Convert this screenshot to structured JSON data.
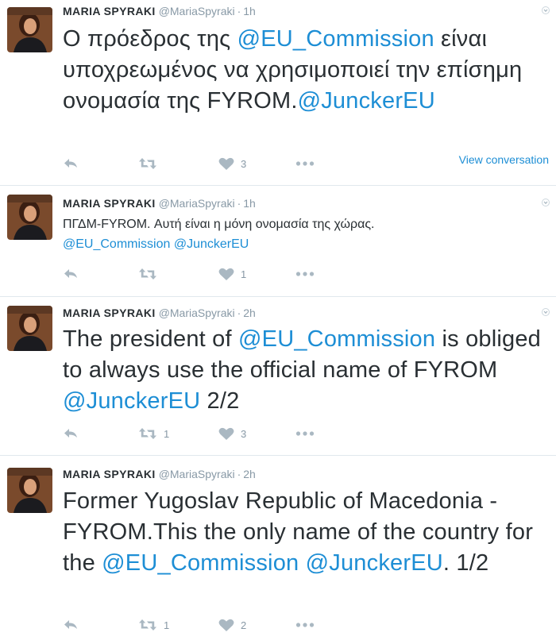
{
  "colors": {
    "link": "#1d8ed5",
    "text": "#292f33",
    "muted": "#8899a6",
    "icon": "#aab8c2",
    "divider": "#e1e8ed"
  },
  "tweets": [
    {
      "author": {
        "name": "MARIA SPYRAKI",
        "handle": "@MariaSpyraki",
        "separator": "·",
        "time": "1h"
      },
      "text_parts": [
        {
          "t": "Ο πρόεδρος της ",
          "m": false
        },
        {
          "t": "@EU_Commission",
          "m": true
        },
        {
          "t": " είναι υποχρεωμένος να χρησιμοποιεί την επίσημη ονομασία της FYROM.",
          "m": false
        },
        {
          "t": "@JunckerEU",
          "m": true
        }
      ],
      "retweets": "",
      "likes": "3",
      "view_conversation": "View conversation"
    },
    {
      "author": {
        "name": "MARIA SPYRAKI",
        "handle": "@MariaSpyraki",
        "separator": "·",
        "time": "1h"
      },
      "text_parts": [
        {
          "t": "ΠΓΔΜ-FYROM. Αυτή είναι η μόνη ονομασία της χώρας. ",
          "m": false
        },
        {
          "t": "@EU_Commission",
          "m": true
        },
        {
          "t": " ",
          "m": false
        },
        {
          "t": "@JunckerEU",
          "m": true
        }
      ],
      "retweets": "",
      "likes": "1"
    },
    {
      "author": {
        "name": "MARIA SPYRAKI",
        "handle": "@MariaSpyraki",
        "separator": "·",
        "time": "2h"
      },
      "text_parts": [
        {
          "t": "The president of ",
          "m": false
        },
        {
          "t": "@EU_Commission",
          "m": true
        },
        {
          "t": " is obliged to always use the official name of FYROM ",
          "m": false
        },
        {
          "t": "@JunckerEU",
          "m": true
        },
        {
          "t": " 2/2",
          "m": false
        }
      ],
      "retweets": "1",
      "likes": "3"
    },
    {
      "author": {
        "name": "MARIA SPYRAKI",
        "handle": "@MariaSpyraki",
        "separator": "·",
        "time": "2h"
      },
      "text_parts": [
        {
          "t": "Former Yugoslav Republic of Macedonia - FYROM.This the only name of the country for the ",
          "m": false
        },
        {
          "t": "@EU_Commission",
          "m": true
        },
        {
          "t": " ",
          "m": false
        },
        {
          "t": "@JunckerEU",
          "m": true
        },
        {
          "t": ". 1/2",
          "m": false
        }
      ],
      "retweets": "1",
      "likes": "2"
    }
  ],
  "icons": {
    "avatar": "avatar-photo",
    "reply": "reply-icon",
    "retweet": "retweet-icon",
    "like": "heart-icon",
    "more": "more-dots-icon",
    "caret": "caret-down-icon"
  }
}
